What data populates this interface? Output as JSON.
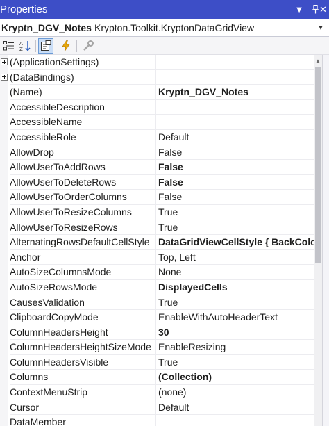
{
  "window": {
    "title": "Properties",
    "dropdown_glyph": "▼",
    "pin_glyph": "📌",
    "close_glyph": "✕"
  },
  "selector": {
    "object_name": "Kryptn_DGV_Notes",
    "object_type": "Krypton.Toolkit.KryptonDataGridView",
    "dropdown_glyph": "▾"
  },
  "toolbar": {
    "buttons": [
      {
        "icon": "categorized-icon",
        "active": false
      },
      {
        "icon": "alphabetical-icon",
        "active": false
      },
      {
        "icon": "properties-icon",
        "active": true
      },
      {
        "icon": "events-icon",
        "active": false
      },
      {
        "icon": "property-pages-icon",
        "active": false
      }
    ]
  },
  "properties": [
    {
      "name": "(ApplicationSettings)",
      "value": "",
      "expandable": true,
      "bold": false
    },
    {
      "name": "(DataBindings)",
      "value": "",
      "expandable": true,
      "bold": false
    },
    {
      "name": "(Name)",
      "value": "Kryptn_DGV_Notes",
      "expandable": false,
      "bold": true
    },
    {
      "name": "AccessibleDescription",
      "value": "",
      "expandable": false,
      "bold": false
    },
    {
      "name": "AccessibleName",
      "value": "",
      "expandable": false,
      "bold": false
    },
    {
      "name": "AccessibleRole",
      "value": "Default",
      "expandable": false,
      "bold": false
    },
    {
      "name": "AllowDrop",
      "value": "False",
      "expandable": false,
      "bold": false
    },
    {
      "name": "AllowUserToAddRows",
      "value": "False",
      "expandable": false,
      "bold": true
    },
    {
      "name": "AllowUserToDeleteRows",
      "value": "False",
      "expandable": false,
      "bold": true
    },
    {
      "name": "AllowUserToOrderColumns",
      "value": "False",
      "expandable": false,
      "bold": false
    },
    {
      "name": "AllowUserToResizeColumns",
      "value": "True",
      "expandable": false,
      "bold": false
    },
    {
      "name": "AllowUserToResizeRows",
      "value": "True",
      "expandable": false,
      "bold": false
    },
    {
      "name": "AlternatingRowsDefaultCellStyle",
      "value": "DataGridViewCellStyle { BackColo",
      "expandable": false,
      "bold": true
    },
    {
      "name": "Anchor",
      "value": "Top, Left",
      "expandable": false,
      "bold": false
    },
    {
      "name": "AutoSizeColumnsMode",
      "value": "None",
      "expandable": false,
      "bold": false
    },
    {
      "name": "AutoSizeRowsMode",
      "value": "DisplayedCells",
      "expandable": false,
      "bold": true
    },
    {
      "name": "CausesValidation",
      "value": "True",
      "expandable": false,
      "bold": false
    },
    {
      "name": "ClipboardCopyMode",
      "value": "EnableWithAutoHeaderText",
      "expandable": false,
      "bold": false
    },
    {
      "name": "ColumnHeadersHeight",
      "value": "30",
      "expandable": false,
      "bold": true
    },
    {
      "name": "ColumnHeadersHeightSizeMode",
      "value": "EnableResizing",
      "expandable": false,
      "bold": false
    },
    {
      "name": "ColumnHeadersVisible",
      "value": "True",
      "expandable": false,
      "bold": false
    },
    {
      "name": "Columns",
      "value": "(Collection)",
      "expandable": false,
      "bold": true
    },
    {
      "name": "ContextMenuStrip",
      "value": "(none)",
      "expandable": false,
      "bold": false
    },
    {
      "name": "Cursor",
      "value": "Default",
      "expandable": false,
      "bold": false
    },
    {
      "name": "DataMember",
      "value": "",
      "expandable": false,
      "bold": false
    }
  ],
  "scrollbar": {
    "up_glyph": "▲"
  },
  "colors": {
    "titlebar": "#3d4ec7",
    "active_button": "#c9ddf6",
    "grid_line": "#ececf0"
  }
}
